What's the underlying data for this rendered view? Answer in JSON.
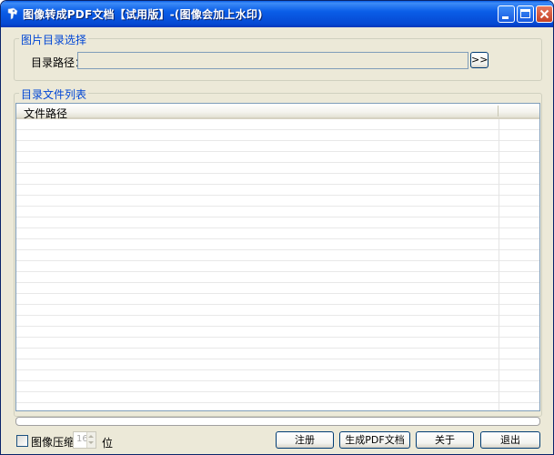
{
  "window": {
    "title": "图像转成PDF文档【试用版】-(图像会加上水印)",
    "controls": {
      "minimize": "minimize-icon",
      "maximize": "maximize-icon",
      "close": "close-icon"
    }
  },
  "image_dir_group": {
    "title": "图片目录选择",
    "path_label": "目录路径：",
    "path_value": "",
    "browse_label": ">>"
  },
  "file_list_group": {
    "title": "目录文件列表",
    "columns": [
      "文件路径",
      ""
    ],
    "rows": []
  },
  "progress": {
    "percent": 0
  },
  "bottom": {
    "compress_checkbox": {
      "label": "图像压缩",
      "checked": false
    },
    "bits_value": "16",
    "bits_unit": "位",
    "buttons": {
      "register": "注册",
      "generate": "生成PDF文档",
      "about": "关于",
      "exit": "退出"
    }
  },
  "colors": {
    "titlebar": "#0a5ee8",
    "group_title": "#0046d5",
    "window_bg": "#ece9d8"
  }
}
